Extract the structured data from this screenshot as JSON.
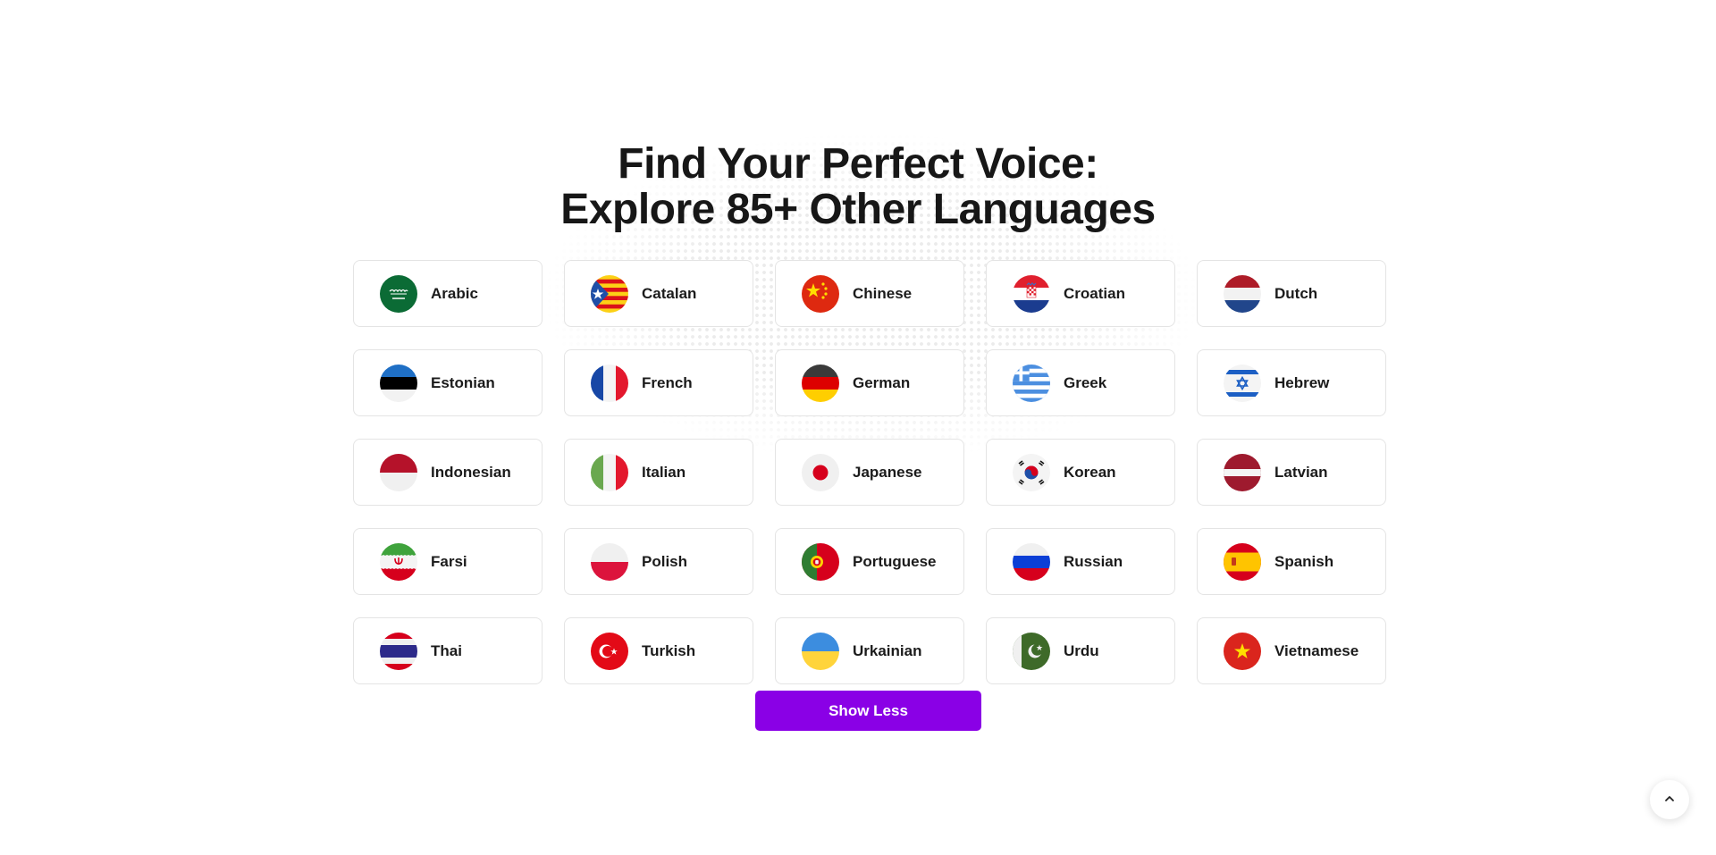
{
  "heading": {
    "line1": "Find Your Perfect Voice:",
    "line2": "Explore 85+ Other Languages"
  },
  "languages": [
    {
      "label": "Arabic",
      "icon": "saudi-flag-icon"
    },
    {
      "label": "Catalan",
      "icon": "catalan-flag-icon"
    },
    {
      "label": "Chinese",
      "icon": "china-flag-icon"
    },
    {
      "label": "Croatian",
      "icon": "croatia-flag-icon"
    },
    {
      "label": "Dutch",
      "icon": "netherlands-flag-icon"
    },
    {
      "label": "Estonian",
      "icon": "estonia-flag-icon"
    },
    {
      "label": "French",
      "icon": "france-flag-icon"
    },
    {
      "label": "German",
      "icon": "germany-flag-icon"
    },
    {
      "label": "Greek",
      "icon": "greece-flag-icon"
    },
    {
      "label": "Hebrew",
      "icon": "israel-flag-icon"
    },
    {
      "label": "Indonesian",
      "icon": "indonesia-flag-icon"
    },
    {
      "label": "Italian",
      "icon": "italy-flag-icon"
    },
    {
      "label": "Japanese",
      "icon": "japan-flag-icon"
    },
    {
      "label": "Korean",
      "icon": "south-korea-flag-icon"
    },
    {
      "label": "Latvian",
      "icon": "latvia-flag-icon"
    },
    {
      "label": "Farsi",
      "icon": "iran-flag-icon"
    },
    {
      "label": "Polish",
      "icon": "poland-flag-icon"
    },
    {
      "label": "Portuguese",
      "icon": "portugal-flag-icon"
    },
    {
      "label": "Russian",
      "icon": "russia-flag-icon"
    },
    {
      "label": "Spanish",
      "icon": "spain-flag-icon"
    },
    {
      "label": "Thai",
      "icon": "thailand-flag-icon"
    },
    {
      "label": "Turkish",
      "icon": "turkey-flag-icon"
    },
    {
      "label": "Urkainian",
      "icon": "ukraine-flag-icon"
    },
    {
      "label": "Urdu",
      "icon": "pakistan-flag-icon"
    },
    {
      "label": "Vietnamese",
      "icon": "vietnam-flag-icon"
    }
  ],
  "show_less_label": "Show Less",
  "scroll_top_icon": "chevron-up-icon",
  "colors": {
    "accent": "#8a00e6",
    "card_border": "#e4e4e4",
    "heading": "#171717"
  }
}
